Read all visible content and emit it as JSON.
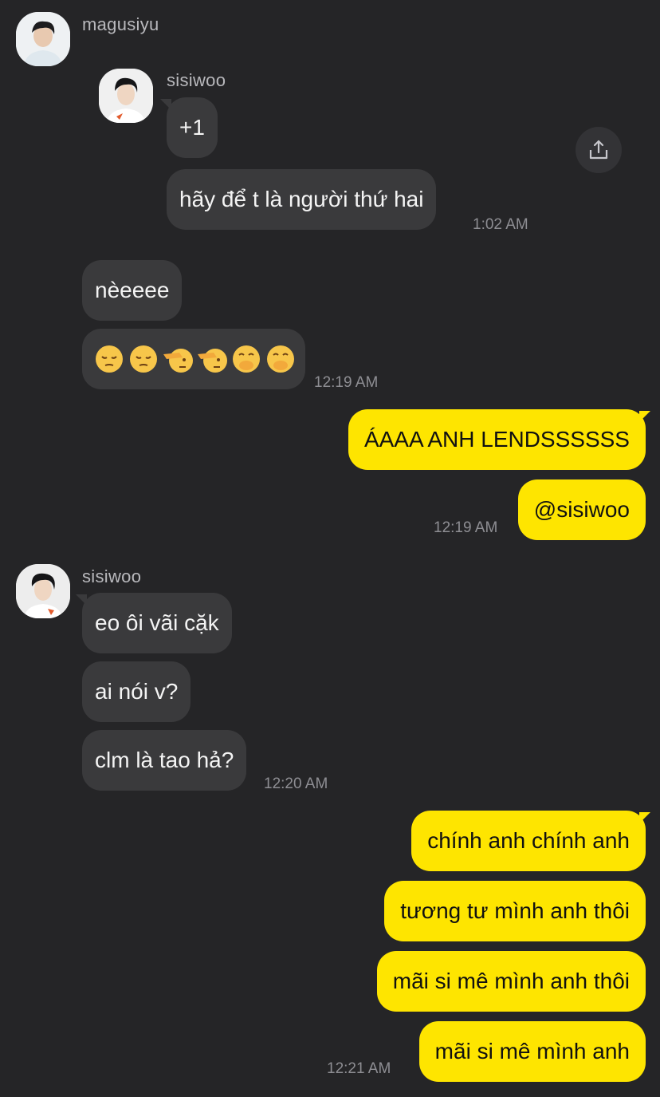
{
  "messages": {
    "group1": {
      "sender": "magusiyu",
      "quoted_sender": "sisiwoo",
      "quoted_bubble": "+1",
      "bubble2": "hãy để t là người thứ hai",
      "time": "1:02 AM"
    },
    "group2": {
      "bubble1": "nèeeee",
      "emoji_names": [
        "pensive-face-icon",
        "pensive-face-icon",
        "saluting-face-icon",
        "saluting-face-icon",
        "face-with-hand-over-mouth-icon",
        "face-with-hand-over-mouth-icon"
      ],
      "time": "12:19 AM"
    },
    "group3": {
      "bubble1": "ÁAAA ANH LENDSSSSSS",
      "bubble2": "@sisiwoo",
      "time": "12:19 AM"
    },
    "group4": {
      "sender": "sisiwoo",
      "bubble1": "eo ôi vãi cặk",
      "bubble2": "ai nói v?",
      "bubble3": "clm là tao hả?",
      "time": "12:20 AM"
    },
    "group5": {
      "bubble1": "chính anh chính anh",
      "bubble2": "tương tư mình anh thôi",
      "bubble3": "mãi si mê mình anh thôi",
      "bubble4": "mãi si mê mình anh",
      "time": "12:21 AM"
    }
  },
  "icons": {
    "share": "share-icon"
  },
  "colors": {
    "background": "#252527",
    "incoming_bubble": "#3a3a3c",
    "outgoing_bubble": "#fee500",
    "timestamp": "#8e8e93"
  }
}
